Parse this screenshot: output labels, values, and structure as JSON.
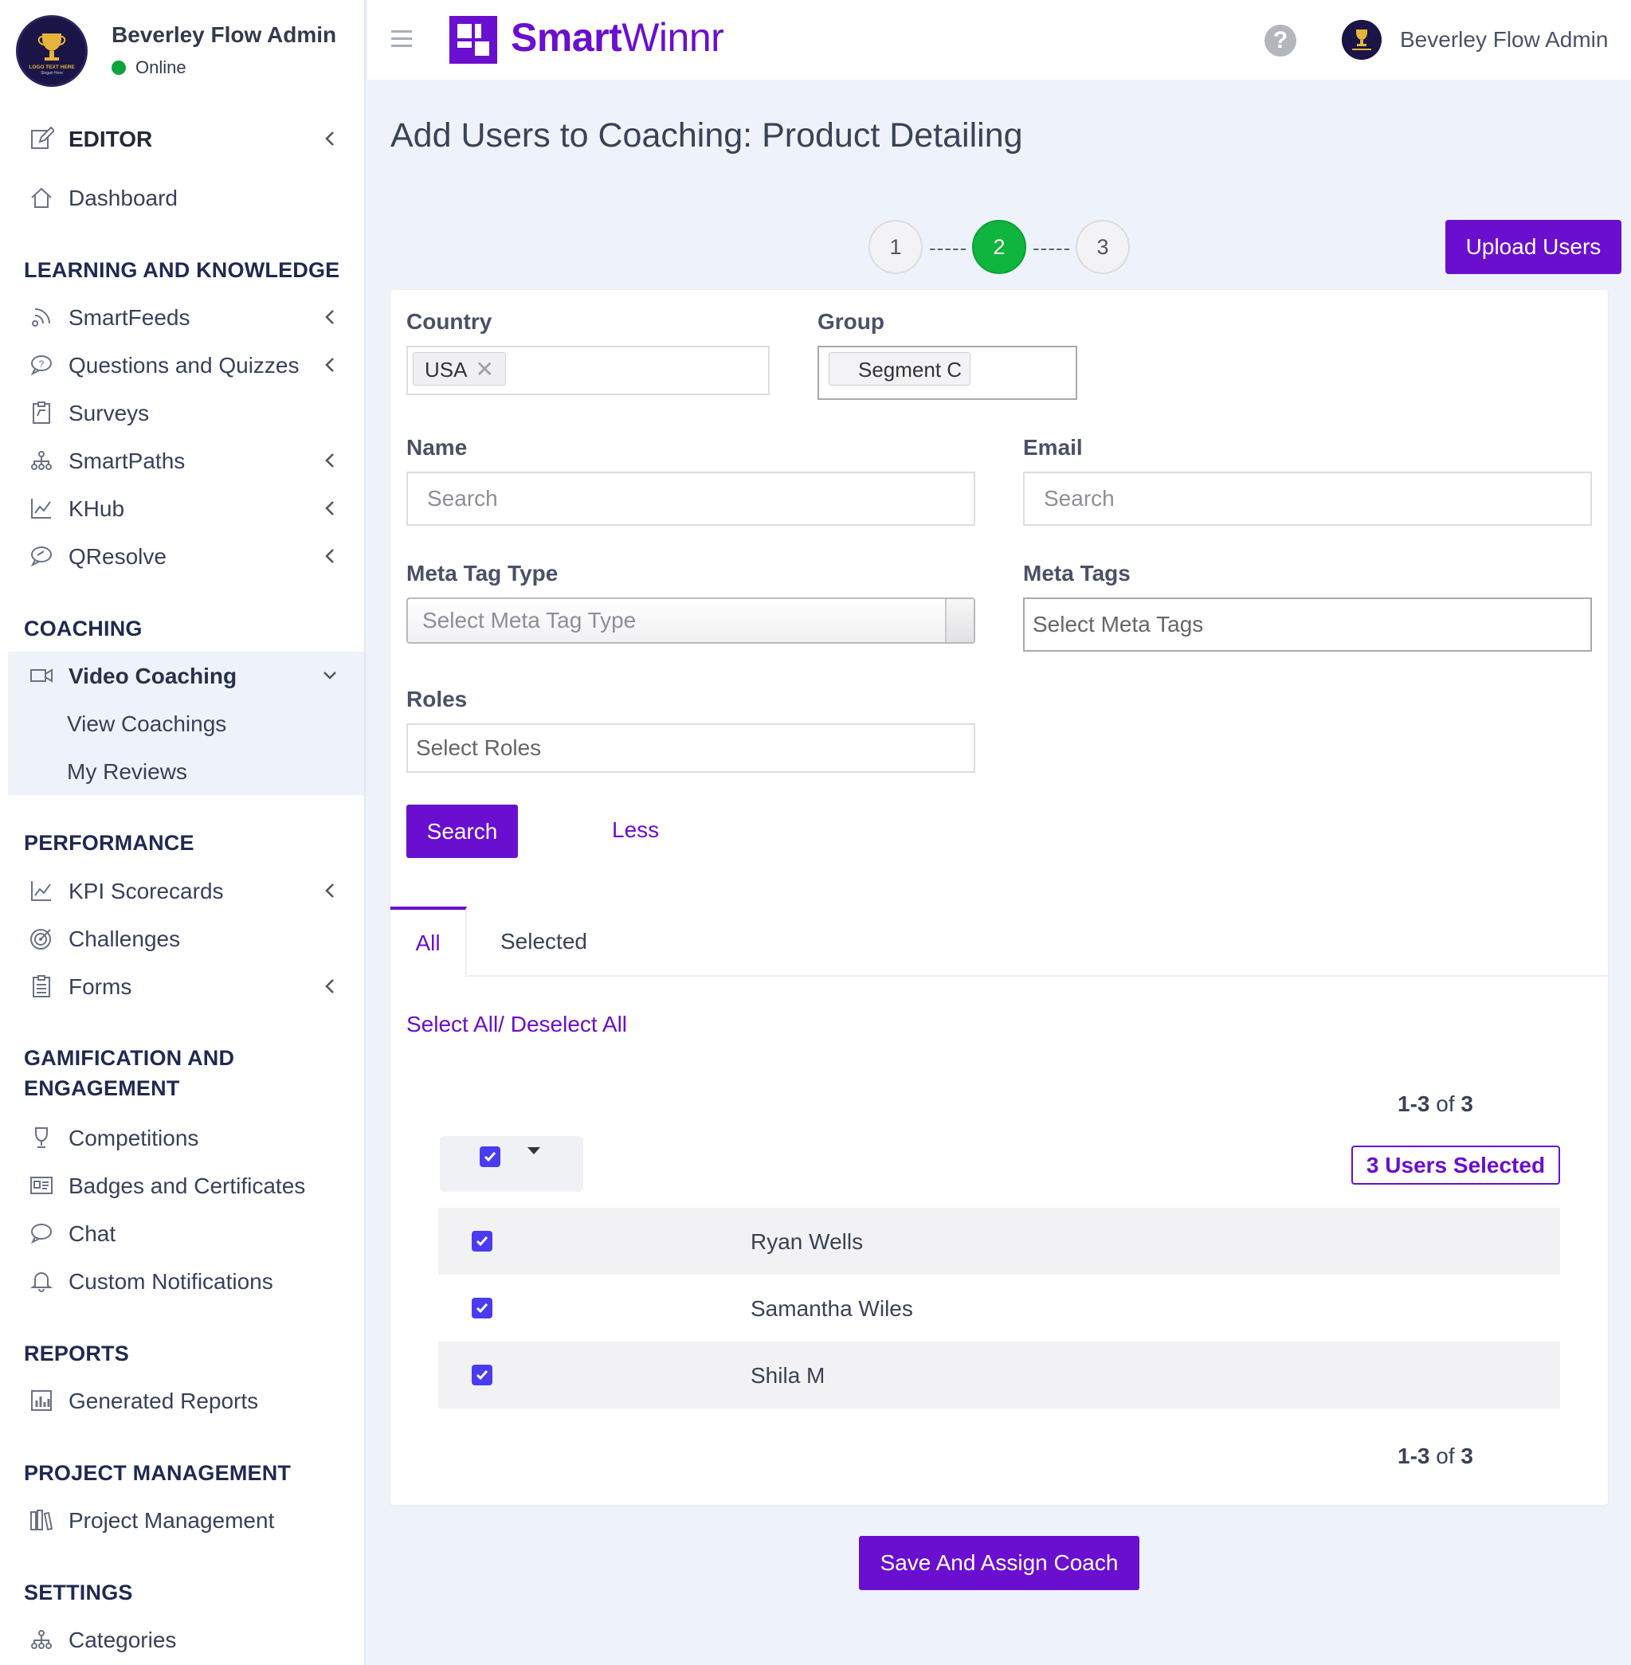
{
  "sidebar": {
    "profile": {
      "name": "Beverley Flow Admin",
      "status": "Online",
      "logo_text": "LOGO TEXT HERE",
      "logo_slogan": "Slogan Here"
    },
    "editor": {
      "label": "EDITOR"
    },
    "dashboard": {
      "label": "Dashboard"
    },
    "sections": {
      "learning": "LEARNING AND KNOWLEDGE",
      "coaching": "COACHING",
      "performance": "PERFORMANCE",
      "gamification": "GAMIFICATION AND ENGAGEMENT",
      "reports": "REPORTS",
      "project": "PROJECT MANAGEMENT",
      "settings": "SETTINGS"
    },
    "items": {
      "smartfeeds": "SmartFeeds",
      "questions": "Questions and Quizzes",
      "surveys": "Surveys",
      "smartpaths": "SmartPaths",
      "khub": "KHub",
      "qresolve": "QResolve",
      "video_coaching": "Video Coaching",
      "view_coachings": "View Coachings",
      "my_reviews": "My Reviews",
      "kpi": "KPI Scorecards",
      "challenges": "Challenges",
      "forms": "Forms",
      "competitions": "Competitions",
      "badges": "Badges and Certificates",
      "chat": "Chat",
      "notifications": "Custom Notifications",
      "generated_reports": "Generated Reports",
      "project_management": "Project Management",
      "categories": "Categories"
    }
  },
  "topbar": {
    "brand_bold": "Smart",
    "brand_light": "Winnr",
    "help_glyph": "?",
    "user_name": "Beverley Flow Admin"
  },
  "page": {
    "title": "Add Users to Coaching: Product Detailing",
    "steps": [
      "1",
      "2",
      "3"
    ],
    "active_step": 2,
    "step_dash": "-----",
    "upload_label": "Upload Users"
  },
  "filters": {
    "country_label": "Country",
    "country_tag": "USA",
    "group_label": "Group",
    "group_tag": "Segment C",
    "name_label": "Name",
    "name_placeholder": "Search",
    "email_label": "Email",
    "email_placeholder": "Search",
    "meta_type_label": "Meta Tag Type",
    "meta_type_placeholder": "Select Meta Tag Type",
    "meta_tags_label": "Meta Tags",
    "meta_tags_placeholder": "Select Meta Tags",
    "roles_label": "Roles",
    "roles_placeholder": "Select Roles",
    "search_label": "Search",
    "less_label": "Less"
  },
  "tabs": {
    "all": "All",
    "selected": "Selected"
  },
  "list": {
    "select_all": "Select All/",
    "deselect_all": " Deselect All",
    "pager_range": "1-3",
    "pager_of": " of ",
    "pager_total": "3",
    "selected_badge": "3 Users Selected",
    "users": [
      "Ryan Wells",
      "Samantha Wiles",
      "Shila M"
    ]
  },
  "footer": {
    "save_label": "Save And Assign Coach"
  },
  "colors": {
    "brand": "#6a0fcf",
    "active_step": "#10b53e",
    "checkbox": "#4a3bf0",
    "online": "#10a33a"
  },
  "icons": {
    "editor": "edit-icon",
    "dashboard": "home-icon",
    "smartfeeds": "feed-icon",
    "questions": "chat-question-icon",
    "surveys": "clipboard-icon",
    "smartpaths": "hierarchy-icon",
    "khub": "chart-line-icon",
    "qresolve": "chat-bubble-icon",
    "video": "video-camera-icon",
    "challenges": "target-icon",
    "forms": "document-list-icon",
    "competitions": "trophy-icon",
    "badges": "id-card-icon",
    "chat": "chat-icon",
    "notifications": "bell-icon",
    "reports": "bar-chart-icon",
    "project": "books-icon",
    "categories": "hierarchy-icon"
  }
}
